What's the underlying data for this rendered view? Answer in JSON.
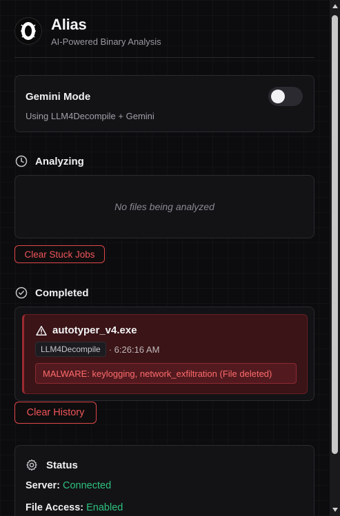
{
  "header": {
    "title": "Alias",
    "subtitle": "AI-Powered Binary Analysis",
    "logo_icon": "eye-logo-icon"
  },
  "gemini_mode": {
    "title": "Gemini Mode",
    "subtitle": "Using LLM4Decompile + Gemini",
    "toggle_on": false
  },
  "analyzing": {
    "heading": "Analyzing",
    "icon": "clock-icon",
    "empty_text": "No files being analyzed",
    "clear_button": "Clear Stuck Jobs"
  },
  "completed": {
    "heading": "Completed",
    "icon": "check-circle-icon",
    "items": [
      {
        "icon": "warning-icon",
        "filename": "autotyper_v4.exe",
        "model": "LLM4Decompile",
        "time": "· 6:26:16 AM",
        "verdict": "MALWARE: keylogging, network_exfiltration (File deleted)"
      }
    ],
    "clear_button": "Clear History"
  },
  "status": {
    "heading": "Status",
    "icon": "gear-icon",
    "server_label": "Server:",
    "server_value": "Connected",
    "file_access_label": "File Access:",
    "file_access_value": "Enabled"
  },
  "colors": {
    "accent_danger": "#f0555a",
    "status_ok": "#2ec27e",
    "background": "#0c0c0e"
  }
}
